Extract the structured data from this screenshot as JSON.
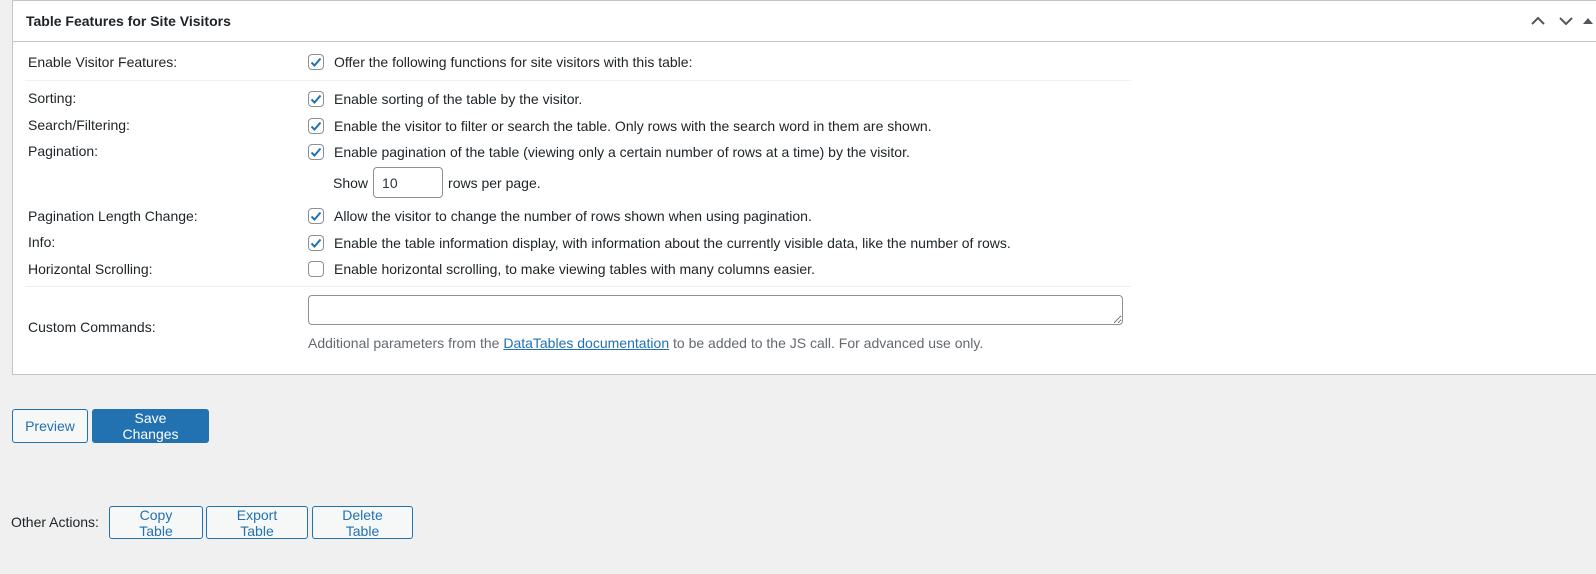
{
  "panel": {
    "title": "Table Features for Site Visitors",
    "header_icons": [
      "chevron-up-icon",
      "chevron-down-icon",
      "triangle-up-icon"
    ]
  },
  "rows": {
    "visitor_features": {
      "label": "Enable Visitor Features:",
      "desc": "Offer the following functions for site visitors with this table:",
      "checked": true
    },
    "sorting": {
      "label": "Sorting:",
      "desc": "Enable sorting of the table by the visitor.",
      "checked": true
    },
    "search": {
      "label": "Search/Filtering:",
      "desc": "Enable the visitor to filter or search the table. Only rows with the search word in them are shown.",
      "checked": true
    },
    "pagination": {
      "label": "Pagination:",
      "desc": "Enable pagination of the table (viewing only a certain number of rows at a time) by the visitor.",
      "checked": true
    },
    "rows_per_page": {
      "prefix": "Show",
      "value": "10",
      "suffix": "rows per page."
    },
    "length_change": {
      "label": "Pagination Length Change:",
      "desc": "Allow the visitor to change the number of rows shown when using pagination.",
      "checked": true
    },
    "info": {
      "label": "Info:",
      "desc": "Enable the table information display, with information about the currently visible data, like the number of rows.",
      "checked": true
    },
    "scrolling": {
      "label": "Horizontal Scrolling:",
      "desc": "Enable horizontal scrolling, to make viewing tables with many columns easier.",
      "checked": false
    },
    "custom_commands": {
      "label": "Custom Commands:",
      "value": "",
      "help_before": "Additional parameters from the",
      "help_link": "DataTables documentation",
      "help_after": "to be added to the JS call. For advanced use only."
    }
  },
  "actions": {
    "preview": "Preview",
    "save": "Save Changes",
    "other_label": "Other Actions:",
    "copy": "Copy Table",
    "export": "Export Table",
    "delete": "Delete Table"
  },
  "colors": {
    "accent": "#2271b1",
    "background": "#f0f0f1",
    "border": "#c3c4c7"
  }
}
